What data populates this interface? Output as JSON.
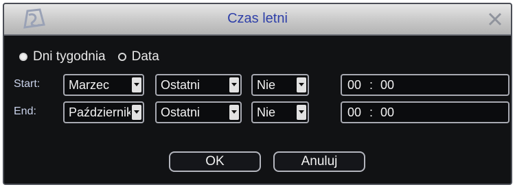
{
  "dialog": {
    "title": "Czas letni",
    "logo_icon": "logo-icon",
    "close_icon": "close-icon"
  },
  "mode": {
    "options": [
      {
        "label": "Dni tygodnia",
        "selected": true
      },
      {
        "label": "Data",
        "selected": false
      }
    ]
  },
  "start": {
    "label": "Start:",
    "month": "Marzec",
    "week": "Ostatni",
    "day": "Nie",
    "hour": "00",
    "minute": "00"
  },
  "end": {
    "label": "End:",
    "month": "Październik",
    "week": "Ostatni",
    "day": "Nie",
    "hour": "00",
    "minute": "00"
  },
  "time_separator": ":",
  "buttons": {
    "ok": "OK",
    "cancel": "Anuluj"
  },
  "colors": {
    "background": "#111214",
    "title_text": "#2e3fa8",
    "text": "#f2f2f2"
  }
}
